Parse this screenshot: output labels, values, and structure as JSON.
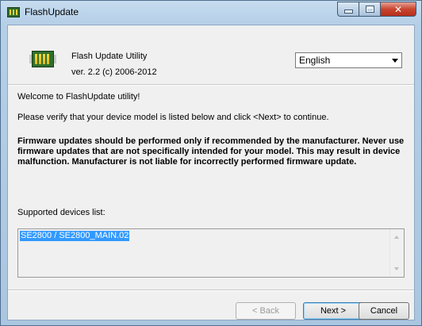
{
  "window": {
    "title": "FlashUpdate"
  },
  "header": {
    "app_name": "Flash Update Utility",
    "version": "ver. 2.2  (c) 2006-2012",
    "language": "English"
  },
  "body": {
    "welcome": "Welcome to FlashUpdate utility!",
    "instruction": "Please verify that your device model is listed below and click <Next> to continue.",
    "warning": "Firmware updates should be performed only if recommended by the manufacturer. Never use firmware updates that are not specifically intended for your model. This may result in device malfunction. Manufacturer is not liable for incorrectly performed firmware update.",
    "devices_label": "Supported devices list:",
    "devices": [
      "SE2800 / SE2800_MAIN.02"
    ]
  },
  "buttons": {
    "back": "< Back",
    "next": "Next >",
    "cancel": "Cancel"
  },
  "colors": {
    "selection": "#3399ff",
    "close_button": "#c9452f"
  }
}
